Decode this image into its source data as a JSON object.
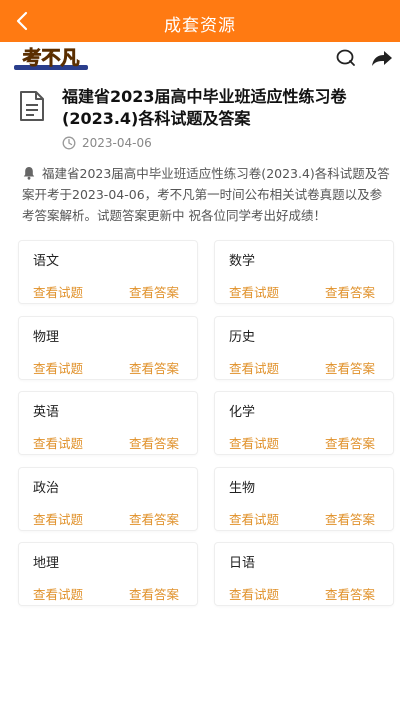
{
  "header": {
    "title": "成套资源"
  },
  "brand": {
    "logo_text": "考不凡"
  },
  "doc": {
    "title": "福建省2023届高中毕业班适应性练习卷(2023.4)各科试题及答案",
    "date": "2023-04-06"
  },
  "notice": {
    "text": "福建省2023届高中毕业班适应性练习卷(2023.4)各科试题及答案开考于2023-04-06，考不凡第一时间公布相关试卷真题以及参考答案解析。试题答案更新中 祝各位同学考出好成绩！"
  },
  "subjects": [
    {
      "name": "语文",
      "view_questions": "查看试题",
      "view_answers": "查看答案"
    },
    {
      "name": "数学",
      "view_questions": "查看试题",
      "view_answers": "查看答案"
    },
    {
      "name": "物理",
      "view_questions": "查看试题",
      "view_answers": "查看答案"
    },
    {
      "name": "历史",
      "view_questions": "查看试题",
      "view_answers": "查看答案"
    },
    {
      "name": "英语",
      "view_questions": "查看试题",
      "view_answers": "查看答案"
    },
    {
      "name": "化学",
      "view_questions": "查看试题",
      "view_answers": "查看答案"
    },
    {
      "name": "政治",
      "view_questions": "查看试题",
      "view_answers": "查看答案"
    },
    {
      "name": "生物",
      "view_questions": "查看试题",
      "view_answers": "查看答案"
    },
    {
      "name": "地理",
      "view_questions": "查看试题",
      "view_answers": "查看答案"
    },
    {
      "name": "日语",
      "view_questions": "查看试题",
      "view_answers": "查看答案"
    }
  ],
  "colors": {
    "accent": "#ff7a12",
    "link": "#e0912a"
  },
  "icons": {
    "back": "chevron-left-icon",
    "comment": "comment-icon",
    "share": "share-icon",
    "doc": "document-icon",
    "clock": "clock-icon",
    "bell": "bell-icon"
  }
}
